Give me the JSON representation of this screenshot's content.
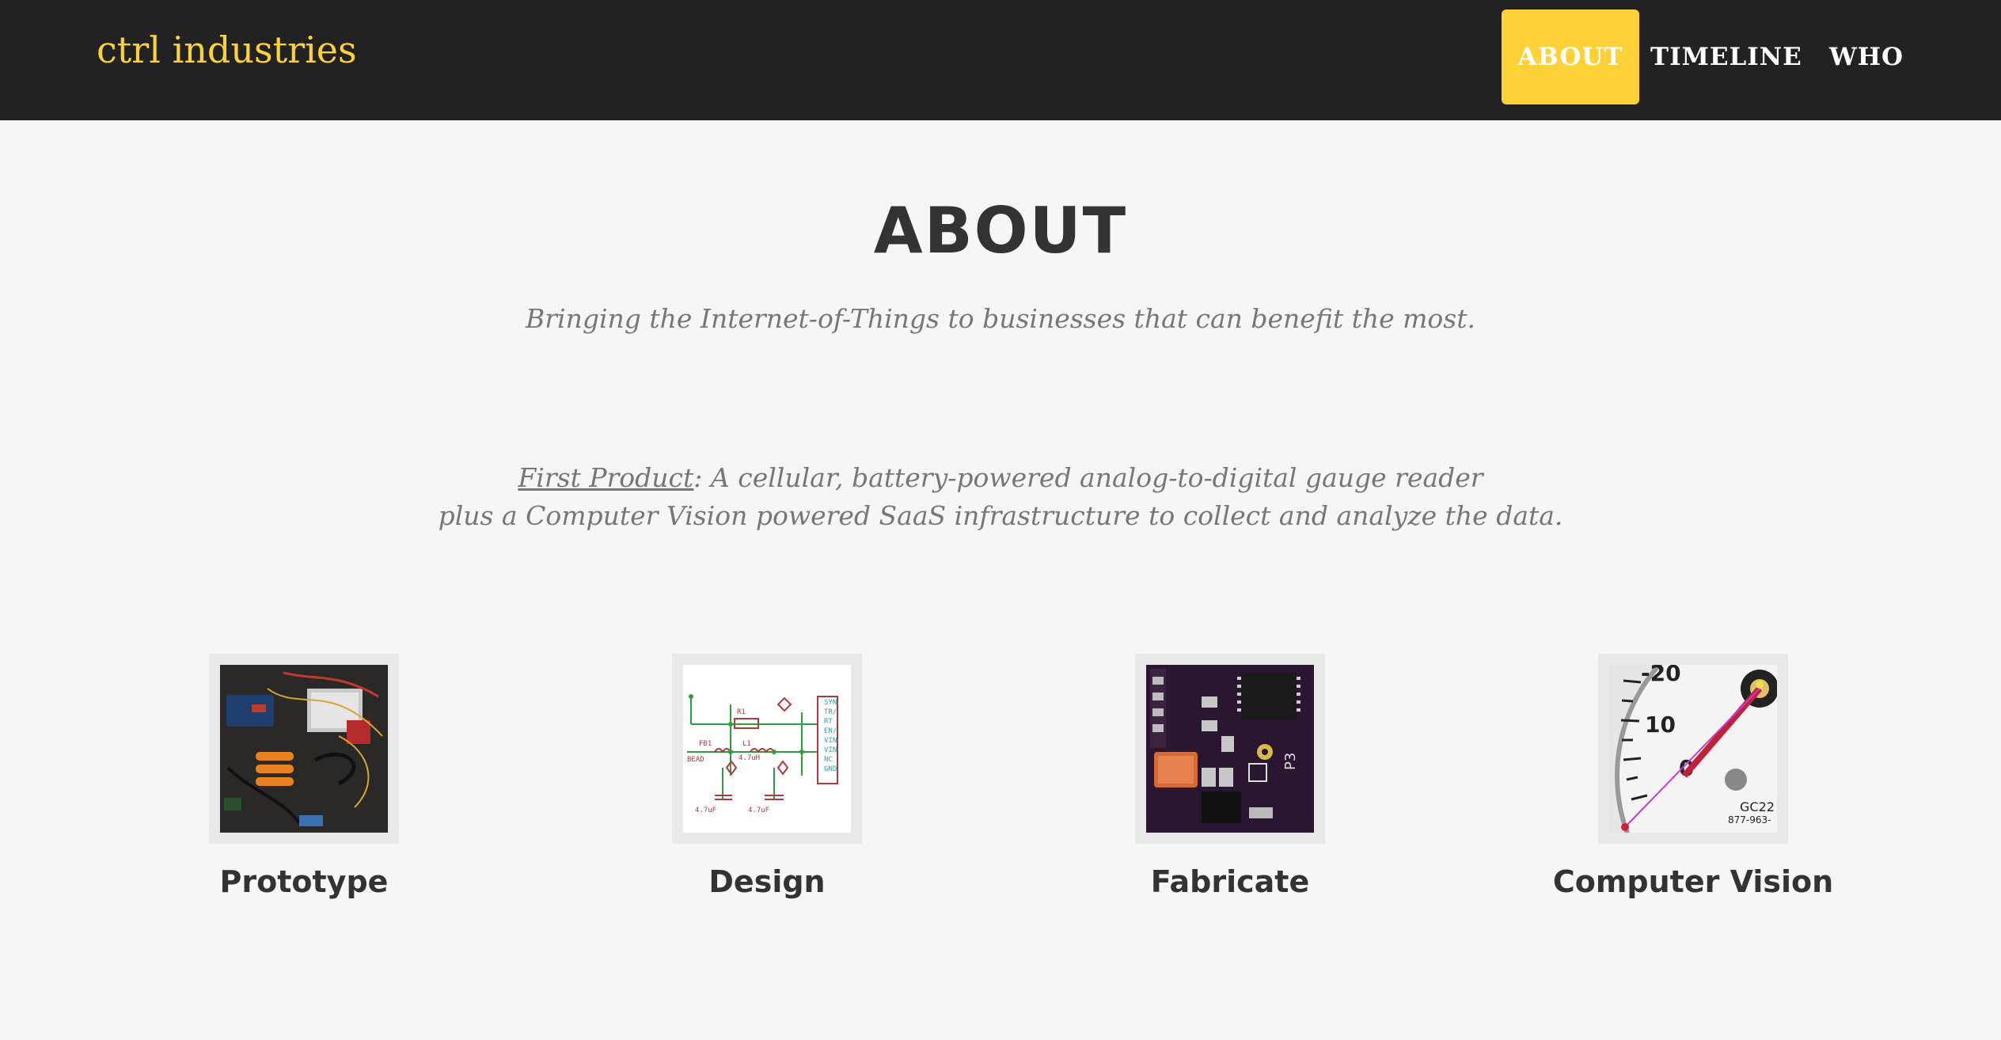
{
  "brand": "ctrl industries",
  "nav": {
    "about": "ABOUT",
    "timeline": "TIMELINE",
    "who": "WHO"
  },
  "about": {
    "title": "ABOUT",
    "subtitle": "Bringing the Internet-of-Things to businesses that can benefit the most.",
    "product_label": "First Product",
    "product_line1_rest": ": A cellular, battery-powered analog-to-digital gauge reader",
    "product_line2": "plus a Computer Vision powered SaaS infrastructure to collect and analyze the data."
  },
  "features": [
    {
      "title": "Prototype",
      "image": "prototype-board-photo"
    },
    {
      "title": "Design",
      "image": "circuit-schematic"
    },
    {
      "title": "Fabricate",
      "image": "pcb-closeup-photo"
    },
    {
      "title": "Computer Vision",
      "image": "gauge-dial-photo"
    }
  ],
  "colors": {
    "navbar": "#222222",
    "accent": "#fed136",
    "background": "#f6f6f6",
    "heading": "#333333",
    "muted": "#777777"
  }
}
